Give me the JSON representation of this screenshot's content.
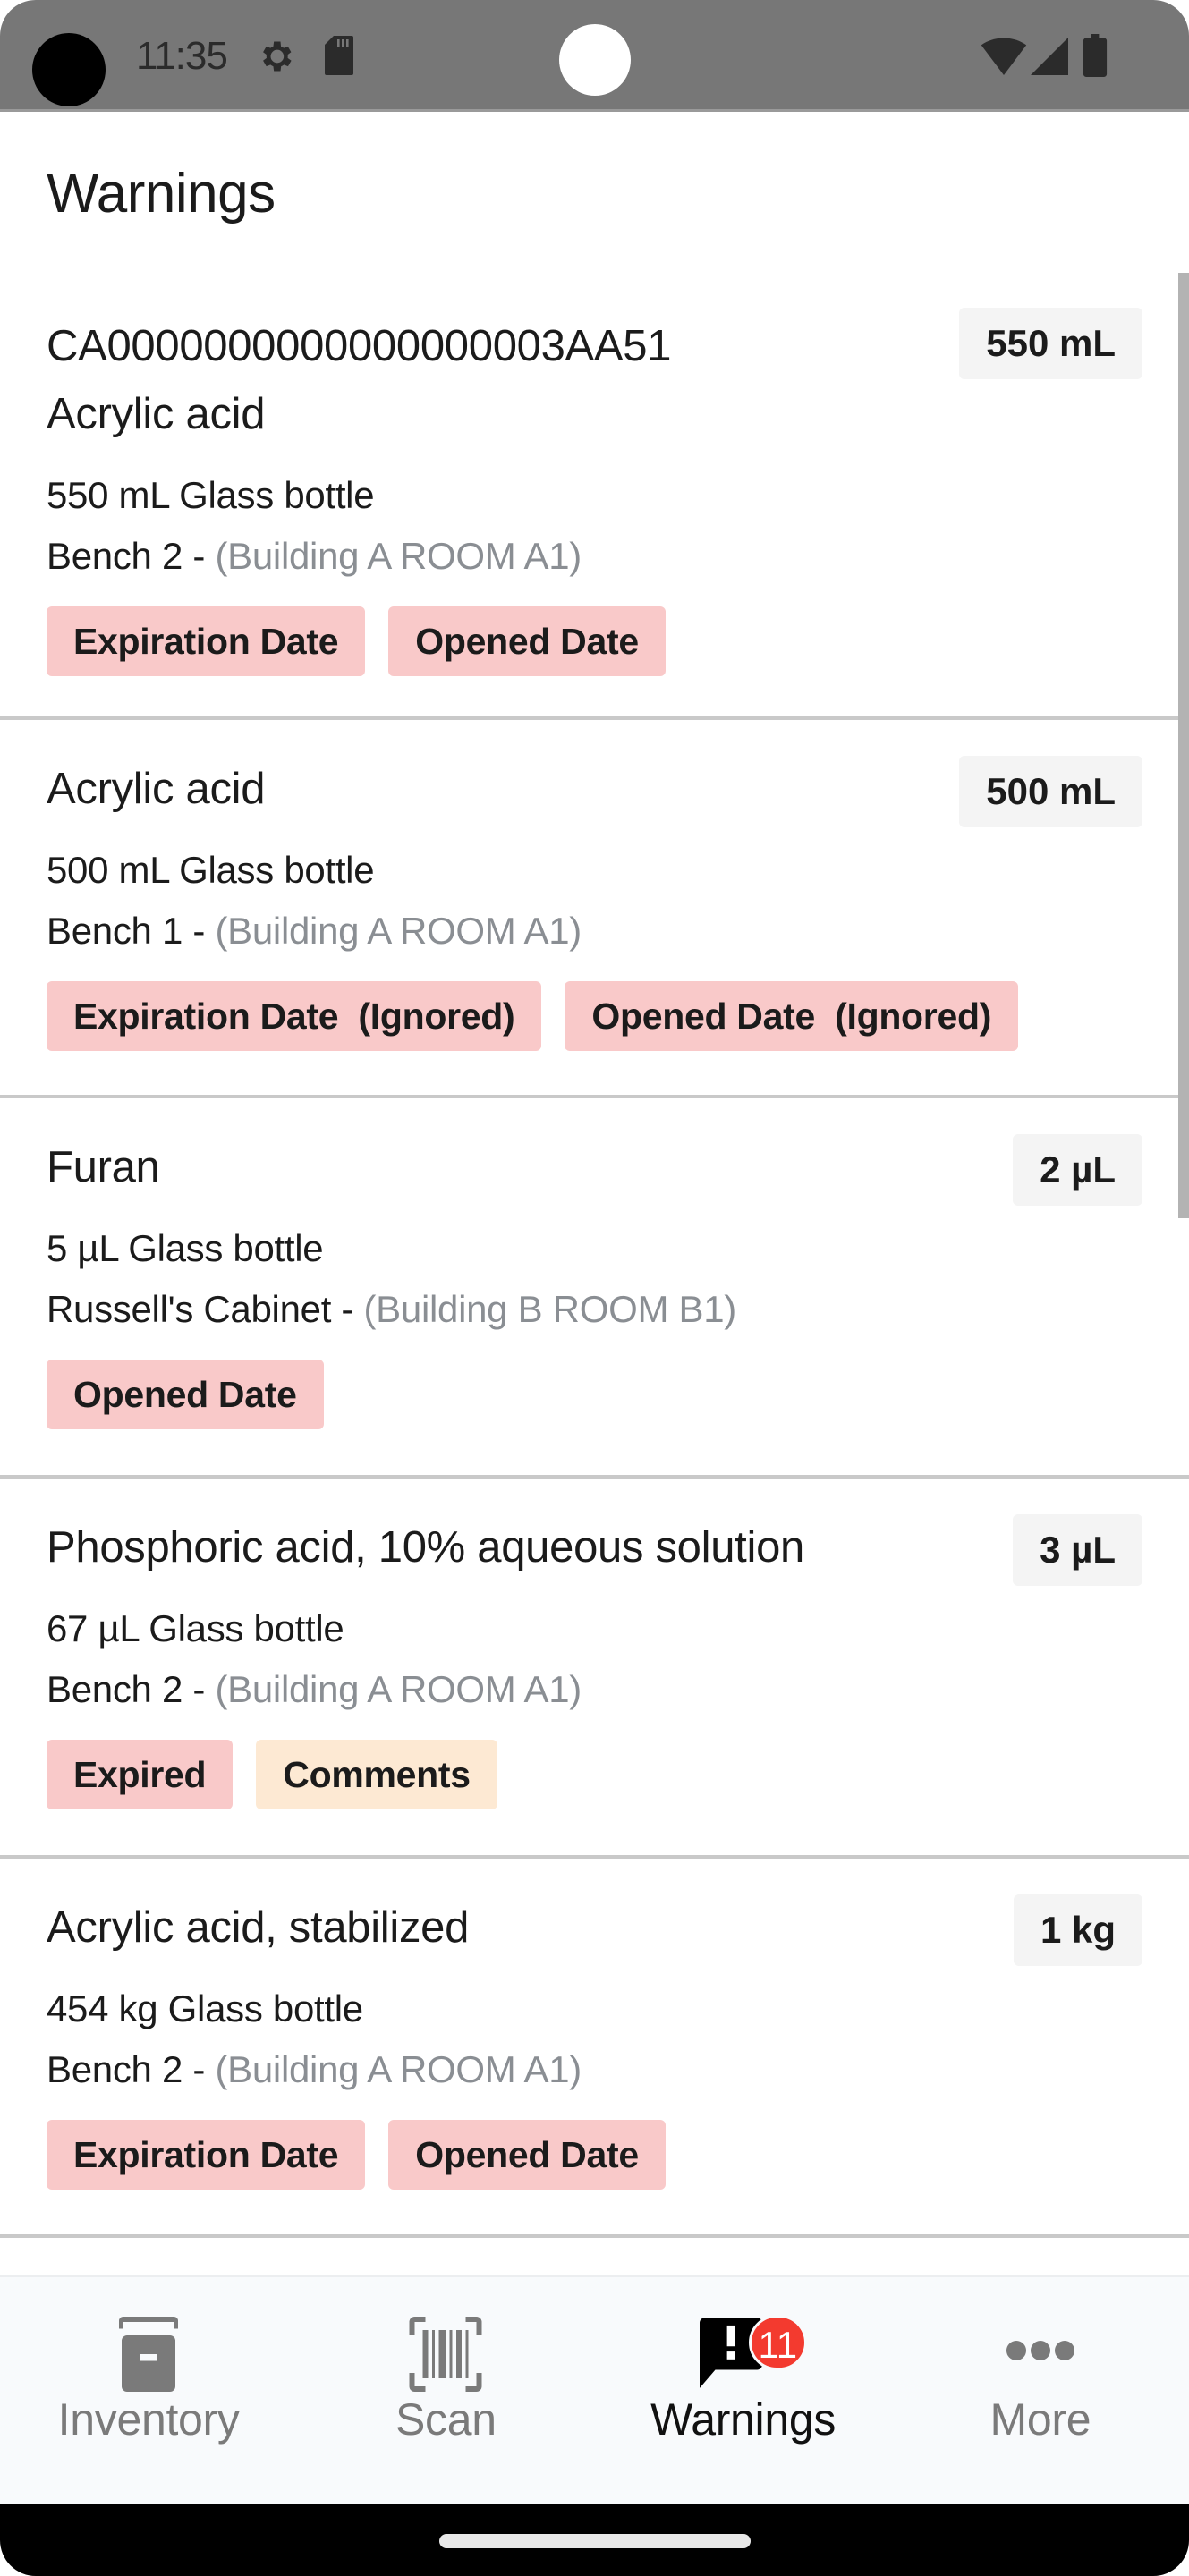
{
  "status_bar": {
    "time": "11:35",
    "left_icons": [
      "settings-gear-icon",
      "sd-card-icon"
    ],
    "right_icons": [
      "wifi-icon",
      "cellular-signal-icon",
      "battery-icon"
    ]
  },
  "header": {
    "title": "Warnings"
  },
  "warnings": [
    {
      "barcode": "CA0000000000000000003AA51",
      "name": "Acrylic acid",
      "quantity": "550 mL",
      "container": "550 mL Glass bottle",
      "location": "Bench 2 - ",
      "location_parent": "(Building A ROOM A1)",
      "tags": [
        {
          "label": "Expiration Date",
          "severity": "red"
        },
        {
          "label": "Opened Date",
          "severity": "red"
        }
      ]
    },
    {
      "barcode": "",
      "name": "Acrylic acid",
      "quantity": "500 mL",
      "container": "500 mL Glass bottle",
      "location": "Bench 1 - ",
      "location_parent": "(Building A ROOM A1)",
      "tags": [
        {
          "label": "Expiration Date  (Ignored)",
          "severity": "red"
        },
        {
          "label": "Opened Date  (Ignored)",
          "severity": "red"
        }
      ]
    },
    {
      "barcode": "",
      "name": "Furan",
      "quantity": "2 µL",
      "container": "5 µL Glass bottle",
      "location": "Russell's Cabinet - ",
      "location_parent": "(Building B ROOM B1)",
      "tags": [
        {
          "label": "Opened Date",
          "severity": "red"
        }
      ]
    },
    {
      "barcode": "",
      "name": "Phosphoric acid, 10% aqueous solution",
      "quantity": "3 µL",
      "container": "67 µL Glass bottle",
      "location": "Bench 2 - ",
      "location_parent": "(Building A ROOM A1)",
      "tags": [
        {
          "label": "Expired",
          "severity": "red"
        },
        {
          "label": "Comments",
          "severity": "orange"
        }
      ]
    },
    {
      "barcode": "",
      "name": "Acrylic acid, stabilized",
      "quantity": "1 kg",
      "container": "454 kg Glass bottle",
      "location": "Bench 2 - ",
      "location_parent": "(Building A ROOM A1)",
      "tags": [
        {
          "label": "Expiration Date",
          "severity": "red"
        },
        {
          "label": "Opened Date",
          "severity": "red"
        }
      ]
    }
  ],
  "bottom_nav": {
    "items": [
      {
        "label": "Inventory",
        "icon": "archive-box-icon",
        "active": false
      },
      {
        "label": "Scan",
        "icon": "barcode-scan-icon",
        "active": false
      },
      {
        "label": "Warnings",
        "icon": "alert-message-icon",
        "active": true,
        "badge": "11"
      },
      {
        "label": "More",
        "icon": "more-dots-icon",
        "active": false
      }
    ]
  },
  "colors": {
    "tag_red": "#f9c9c9",
    "tag_orange": "#fde9d3",
    "badge": "#f33a2f",
    "quantity_chip": "#f4f4f4",
    "nav_inactive": "#7a7a7a",
    "nav_active": "#111111",
    "location_parent": "#8a8e93"
  }
}
